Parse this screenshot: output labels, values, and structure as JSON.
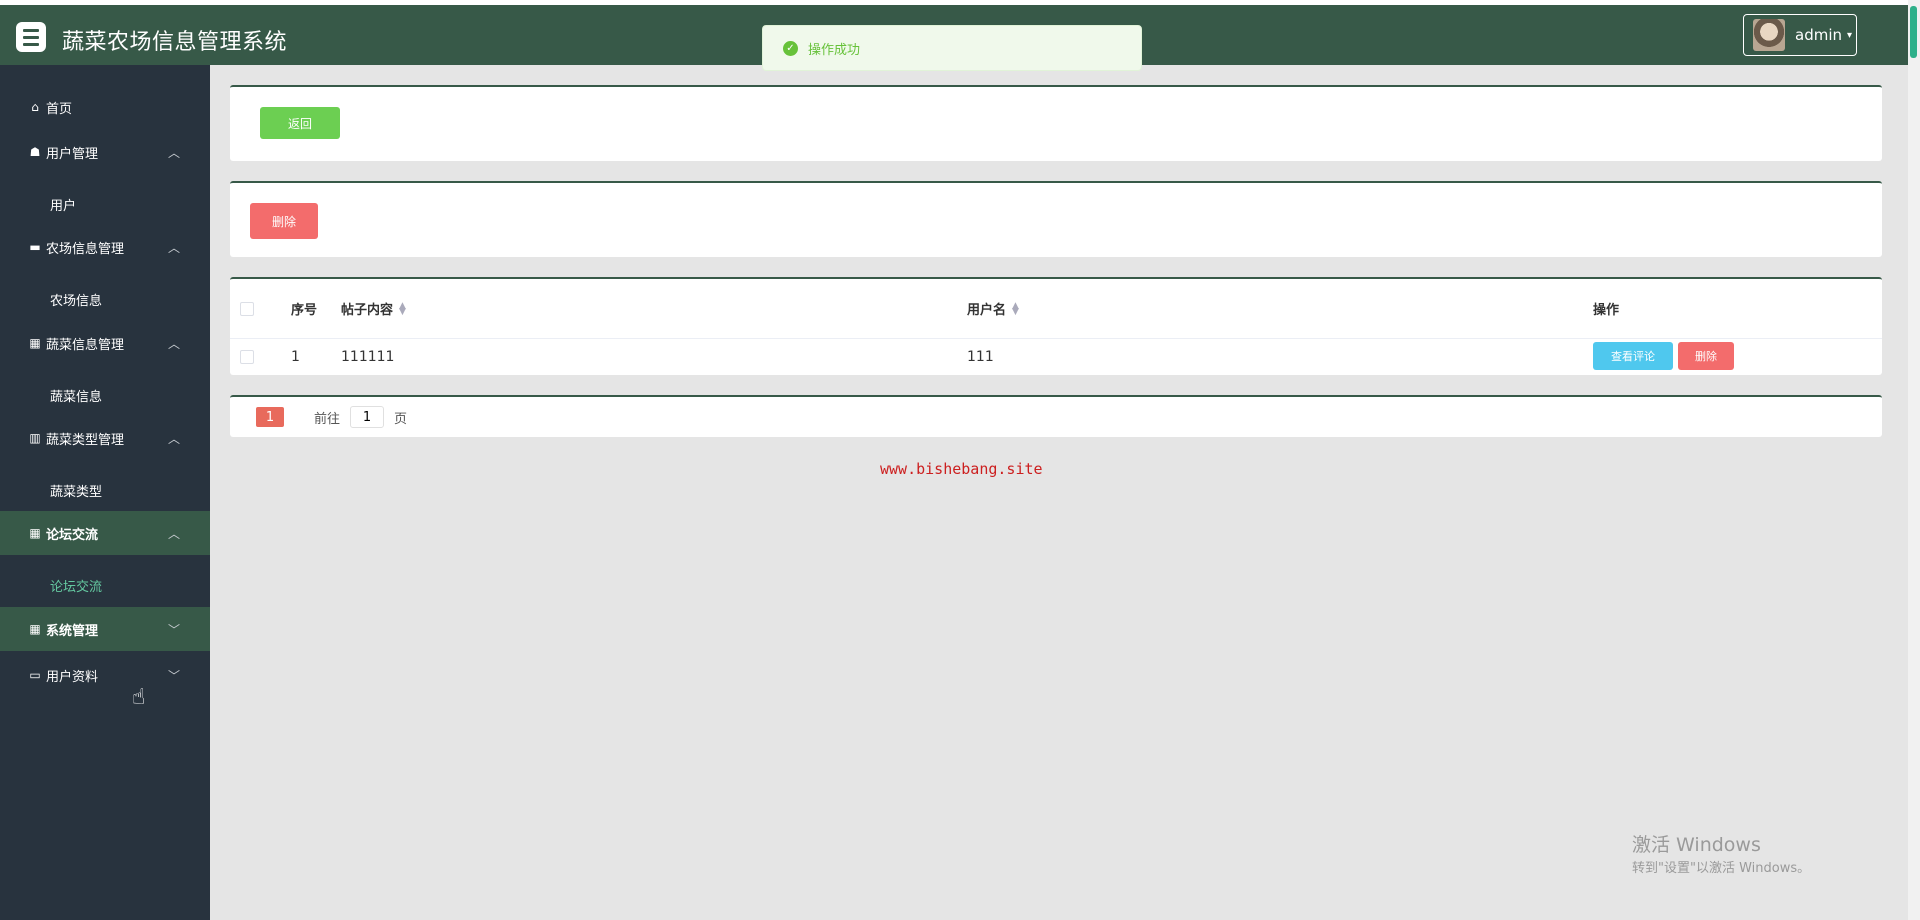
{
  "header": {
    "title": "蔬菜农场信息管理系统",
    "user": "admin",
    "user_caret": "▾"
  },
  "toast": {
    "message": "操作成功",
    "icon": "✓"
  },
  "sidebar": {
    "items": [
      {
        "label": "首页",
        "icon": "home-icon"
      },
      {
        "label": "用户管理",
        "icon": "users-icon"
      },
      {
        "label": "用户",
        "icon": ""
      },
      {
        "label": "农场信息管理",
        "icon": "ticket-icon"
      },
      {
        "label": "农场信息",
        "icon": ""
      },
      {
        "label": "蔬菜信息管理",
        "icon": "grid-icon"
      },
      {
        "label": "蔬菜信息",
        "icon": ""
      },
      {
        "label": "蔬菜类型管理",
        "icon": "chart-icon"
      },
      {
        "label": "蔬菜类型",
        "icon": ""
      },
      {
        "label": "论坛交流",
        "icon": "grid-icon"
      },
      {
        "label": "论坛交流",
        "icon": ""
      },
      {
        "label": "系统管理",
        "icon": "grid-icon"
      },
      {
        "label": "用户资料",
        "icon": "calendar-icon"
      }
    ]
  },
  "main": {
    "back_button": "返回",
    "delete_button": "删除",
    "table": {
      "columns": [
        "序号",
        "帖子内容",
        "用户名",
        "操作"
      ],
      "rows": [
        {
          "index": "1",
          "content": "111111",
          "username": "111"
        }
      ],
      "view_comments_button": "查看评论",
      "row_delete_button": "删除"
    },
    "pagination": {
      "current_page": "1",
      "goto_label": "前往",
      "goto_value": "1",
      "page_suffix": "页"
    }
  },
  "watermark": "www.bishebang.site",
  "windows_activation": {
    "title": "激活 Windows",
    "subtitle": "转到\"设置\"以激活 Windows。"
  },
  "colors": {
    "header_bg": "#375948",
    "sidebar_bg": "#28333e",
    "success": "#67c23a",
    "danger": "#f36c6c",
    "info": "#4fc8ee",
    "page_active": "#e86a5c"
  }
}
